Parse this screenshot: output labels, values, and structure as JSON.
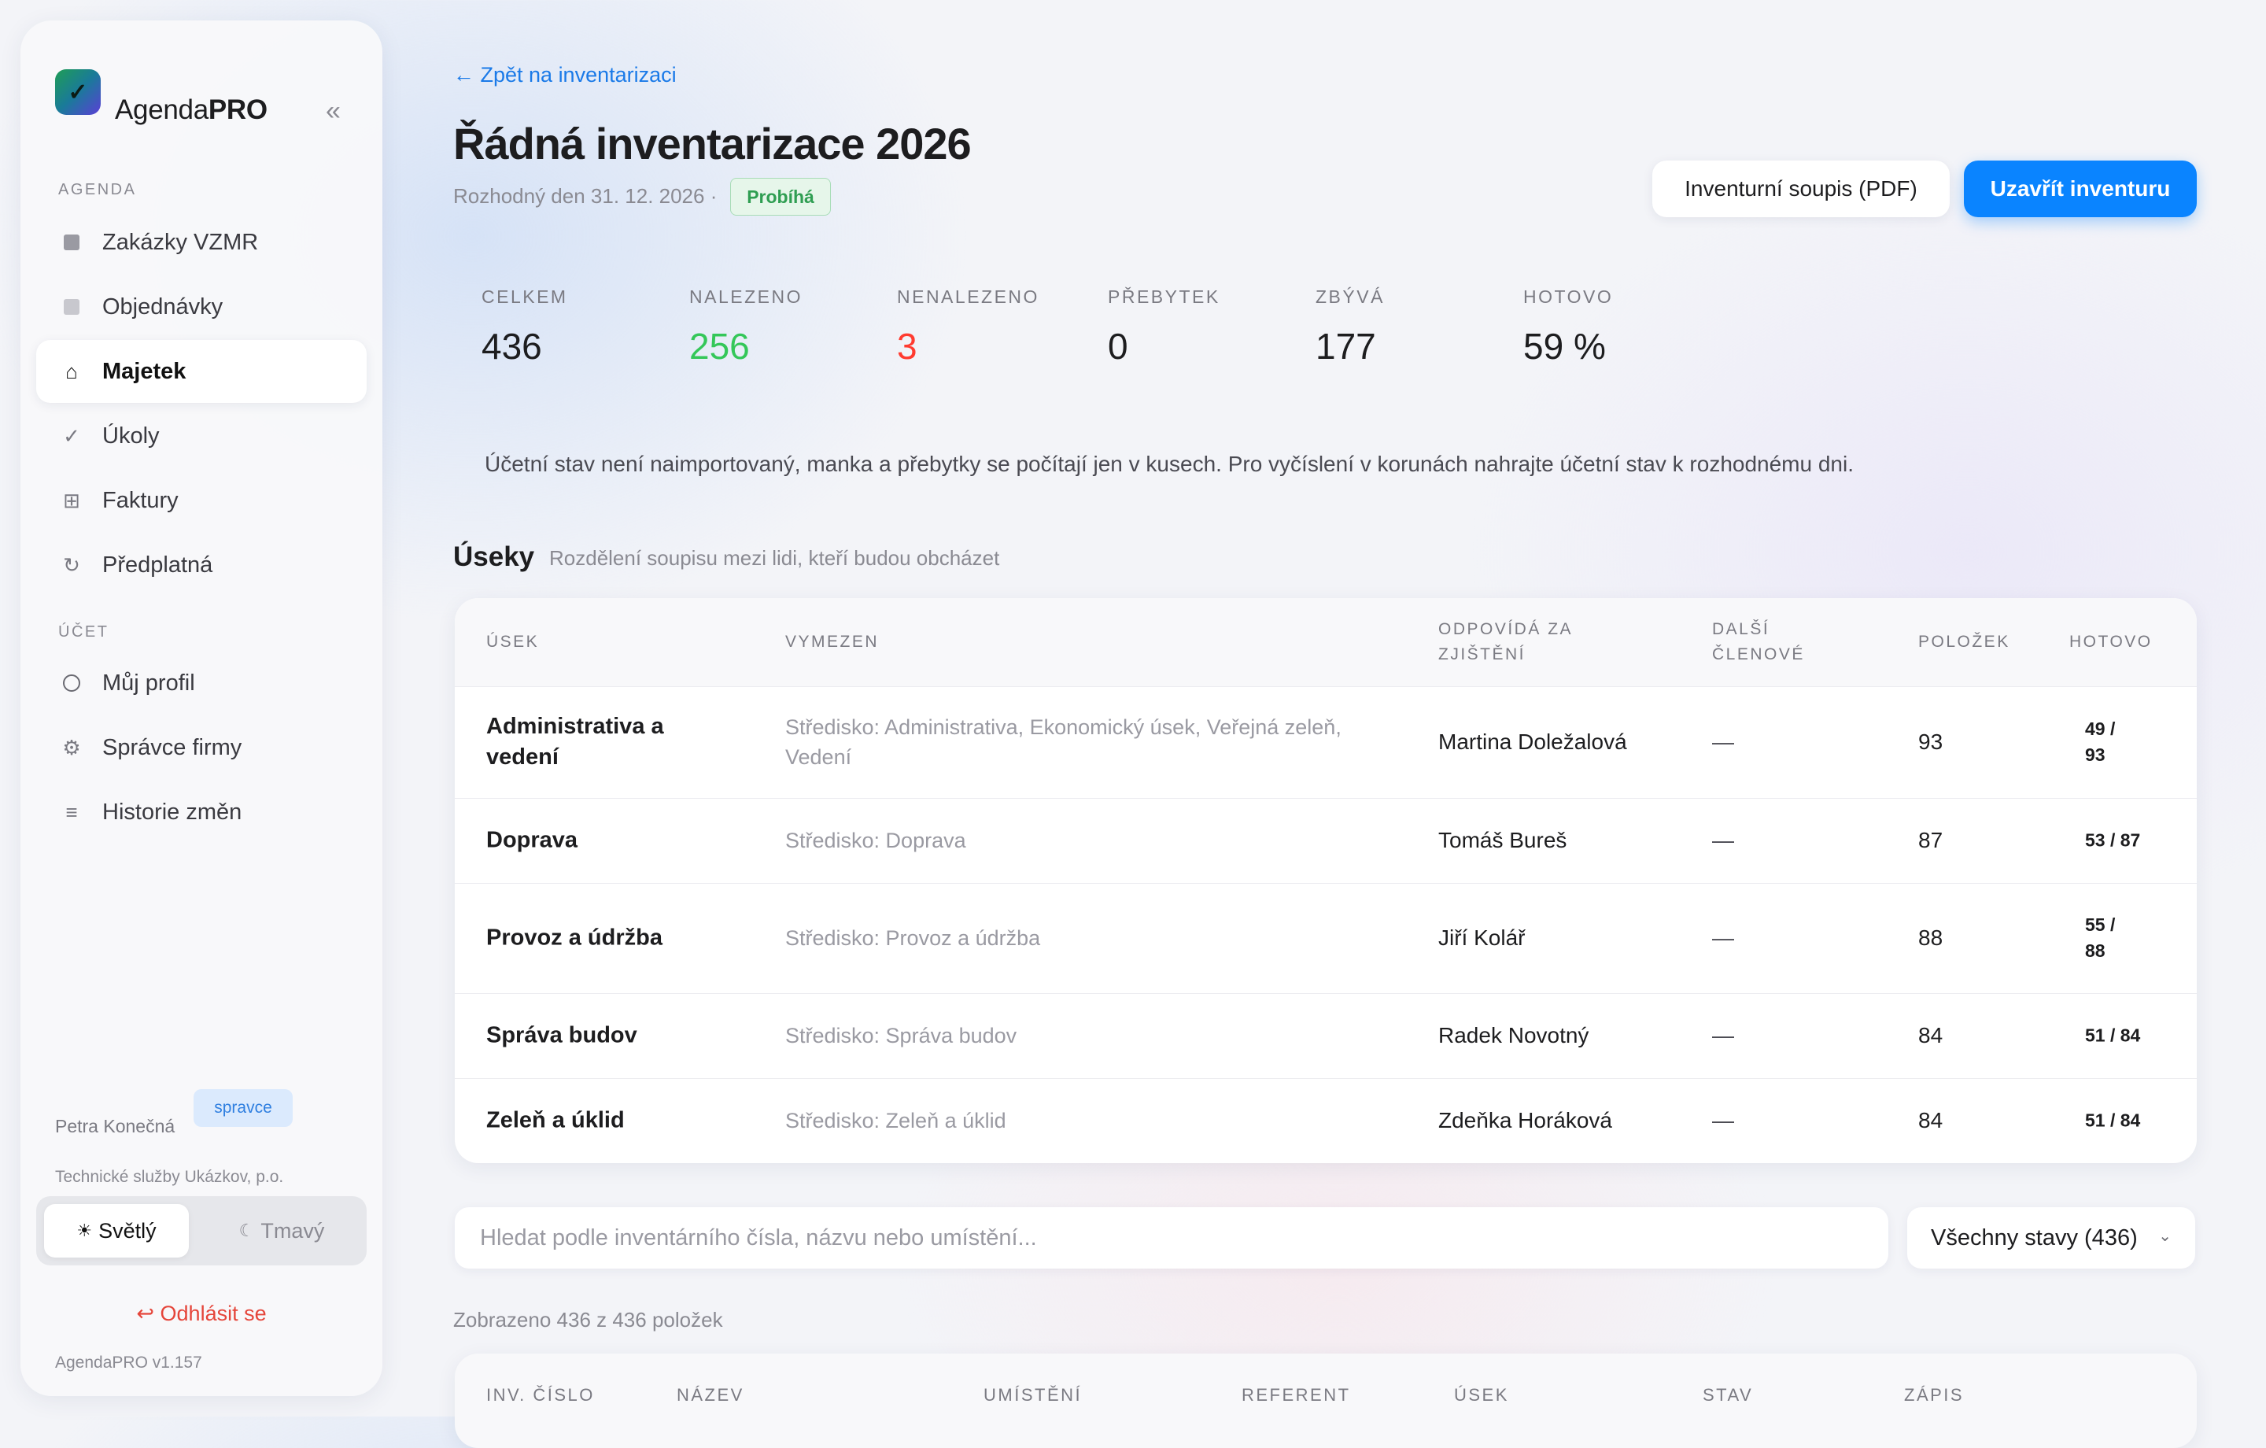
{
  "app": {
    "brand_regular": "Agenda",
    "brand_bold": "PRO",
    "collapse_icon": "«",
    "version": "AgendaPRO v1.157"
  },
  "sidebar": {
    "agenda_label": "AGENDA",
    "account_label": "ÚČET",
    "agenda_items": [
      {
        "label": "Zakázky VZMR",
        "icon": "square-icon"
      },
      {
        "label": "Objednávky",
        "icon": "square-outline-icon"
      },
      {
        "label": "Majetek",
        "icon": "home-icon",
        "active": true
      },
      {
        "label": "Úkoly",
        "icon": "check-icon"
      },
      {
        "label": "Faktury",
        "icon": "grid-icon"
      },
      {
        "label": "Předplatná",
        "icon": "refresh-icon"
      }
    ],
    "account_items": [
      {
        "label": "Můj profil",
        "icon": "circle-icon"
      },
      {
        "label": "Správce firmy",
        "icon": "gear-icon"
      },
      {
        "label": "Historie změn",
        "icon": "list-icon"
      }
    ],
    "user": {
      "name": "Petra Konečná",
      "role": "spravce",
      "org": "Technické služby Ukázkov, p.o."
    },
    "theme": {
      "light": "Světlý",
      "dark": "Tmavý",
      "selected": "light"
    },
    "logout": "Odhlásit se"
  },
  "header": {
    "back_link": "← Zpět na inventarizaci",
    "title": "Řádná inventarizace 2026",
    "subtitle": "Rozhodný den 31. 12. 2026 ·",
    "status": "Probíhá",
    "btn_pdf": "Inventurní soupis (PDF)",
    "btn_close": "Uzavřít inventuru"
  },
  "stats": [
    {
      "label": "CELKEM",
      "value": "436",
      "color": "#1d1d1f"
    },
    {
      "label": "NALEZENO",
      "value": "256",
      "color": "#34c759"
    },
    {
      "label": "NENALEZENO",
      "value": "3",
      "color": "#ff3b30"
    },
    {
      "label": "PŘEBYTEK",
      "value": "0",
      "color": "#1d1d1f"
    },
    {
      "label": "ZBÝVÁ",
      "value": "177",
      "color": "#1d1d1f"
    },
    {
      "label": "HOTOVO",
      "value": "59 %",
      "color": "#1d1d1f"
    }
  ],
  "notice": "Účetní stav není naimportovaný, manka a přebytky se počítají jen v kusech. Pro vyčíslení v korunách nahrajte účetní stav k rozhodnému dni.",
  "sections": {
    "title": "Úseky",
    "subtitle": "Rozdělení soupisu mezi lidi, kteří budou obcházet",
    "headers": {
      "name": "ÚSEK",
      "defined": "VYMEZEN",
      "responsible": "ODPOVÍDÁ ZA ZJIŠTĚNÍ",
      "others": "DALŠÍ ČLENOVÉ",
      "count": "POLOŽEK",
      "done": "HOTOVO"
    },
    "rows": [
      {
        "name": "Administrativa a vedení",
        "defined": "Středisko: Administrativa, Ekonomický úsek, Veřejná zeleň, Vedení",
        "responsible": "Martina Doležalová",
        "others": "—",
        "count": "93",
        "done": "49 / 93"
      },
      {
        "name": "Doprava",
        "defined": "Středisko: Doprava",
        "responsible": "Tomáš Bureš",
        "others": "—",
        "count": "87",
        "done": "53 / 87"
      },
      {
        "name": "Provoz a údržba",
        "defined": "Středisko: Provoz a údržba",
        "responsible": "Jiří Kolář",
        "others": "—",
        "count": "88",
        "done": "55 / 88"
      },
      {
        "name": "Správa budov",
        "defined": "Středisko: Správa budov",
        "responsible": "Radek Novotný",
        "others": "—",
        "count": "84",
        "done": "51 / 84"
      },
      {
        "name": "Zeleň a úklid",
        "defined": "Středisko: Zeleň a úklid",
        "responsible": "Zdeňka Horáková",
        "others": "—",
        "count": "84",
        "done": "51 / 84"
      }
    ]
  },
  "filters": {
    "search_placeholder": "Hledat podle inventárního čísla, názvu nebo umístění...",
    "status_select": "Všechny stavy (436)"
  },
  "items": {
    "shown": "Zobrazeno 436 z 436 položek",
    "headers": [
      "INV. ČÍSLO",
      "NÁZEV",
      "UMÍSTĚNÍ",
      "REFERENT",
      "ÚSEK",
      "STAV",
      "ZÁPIS"
    ]
  }
}
